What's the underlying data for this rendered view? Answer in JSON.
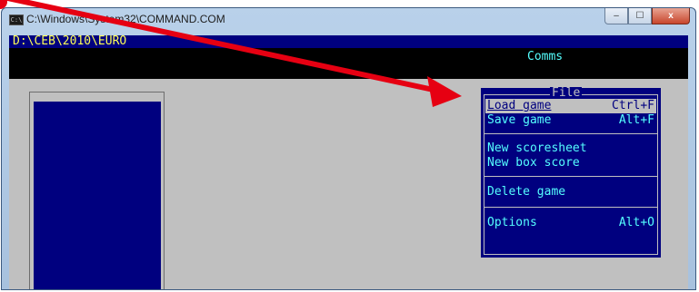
{
  "window": {
    "title": "C:\\Windows\\System32\\COMMAND.COM",
    "app_icon_text": "C:\\",
    "buttons": {
      "minimize": "–",
      "maximize": "☐",
      "close": "x"
    }
  },
  "console": {
    "path": "D:\\CEB\\2010\\EURO",
    "menubar_item": "Comms"
  },
  "menu": {
    "title": "File",
    "items": [
      {
        "label": "Load game",
        "shortcut": "Ctrl+F",
        "selected": true
      },
      {
        "label": "Save game",
        "shortcut": "Alt+F"
      },
      {
        "label": "New scoresheet",
        "shortcut": ""
      },
      {
        "label": "New box score",
        "shortcut": ""
      },
      {
        "label": "Delete game",
        "shortcut": ""
      },
      {
        "label": "Options",
        "shortcut": "Alt+O"
      }
    ]
  },
  "colors": {
    "console_bg": "#c0c0c0",
    "dos_blue": "#00007f",
    "dos_yellow": "#ffff55",
    "dos_cyan": "#55ffff",
    "annotation_red": "#e60012"
  }
}
